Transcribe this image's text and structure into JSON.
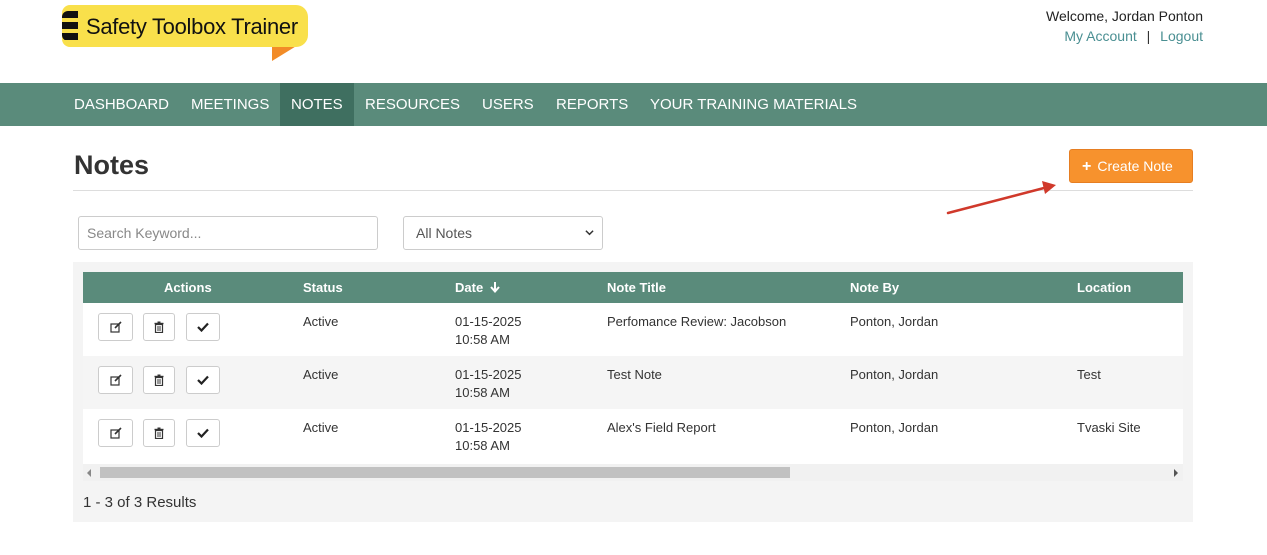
{
  "brand": {
    "logo_text": "Safety Toolbox Trainer"
  },
  "header": {
    "welcome": "Welcome, Jordan Ponton",
    "my_account": "My Account",
    "separator": "|",
    "logout": "Logout"
  },
  "nav": {
    "items": [
      {
        "label": "DASHBOARD",
        "active": false
      },
      {
        "label": "MEETINGS",
        "active": false
      },
      {
        "label": "NOTES",
        "active": true
      },
      {
        "label": "RESOURCES",
        "active": false
      },
      {
        "label": "USERS",
        "active": false
      },
      {
        "label": "REPORTS",
        "active": false
      },
      {
        "label": "YOUR TRAINING MATERIALS",
        "active": false
      }
    ]
  },
  "page": {
    "title": "Notes",
    "create_button": {
      "icon": "plus-icon",
      "label": "Create Note"
    }
  },
  "filters": {
    "search_placeholder": "Search Keyword...",
    "search_value": "",
    "select_value": "All Notes"
  },
  "table": {
    "headers": {
      "actions": "Actions",
      "status": "Status",
      "date": "Date",
      "title": "Note Title",
      "by": "Note By",
      "location": "Location"
    },
    "sort": {
      "column": "date",
      "direction": "descending",
      "icon": "arrow-down-icon"
    },
    "row_action_icons": [
      "edit-icon",
      "trash-icon",
      "checkmark-icon"
    ],
    "rows": [
      {
        "status": "Active",
        "date": "01-15-2025",
        "time": "10:58 AM",
        "title": "Perfomance Review: Jacobson",
        "by": "Ponton, Jordan",
        "location": ""
      },
      {
        "status": "Active",
        "date": "01-15-2025",
        "time": "10:58 AM",
        "title": "Test Note",
        "by": "Ponton, Jordan",
        "location": "Test"
      },
      {
        "status": "Active",
        "date": "01-15-2025",
        "time": "10:58 AM",
        "title": "Alex's Field Report",
        "by": "Ponton, Jordan",
        "location": "Tvaski Site"
      }
    ]
  },
  "results_text": "1 - 3 of 3 Results",
  "colors": {
    "nav_bg": "#5a8b7b",
    "nav_active": "#3f6f60",
    "accent_orange": "#f7922d",
    "link": "#4a8f92",
    "logo_yellow": "#f9e04b"
  }
}
